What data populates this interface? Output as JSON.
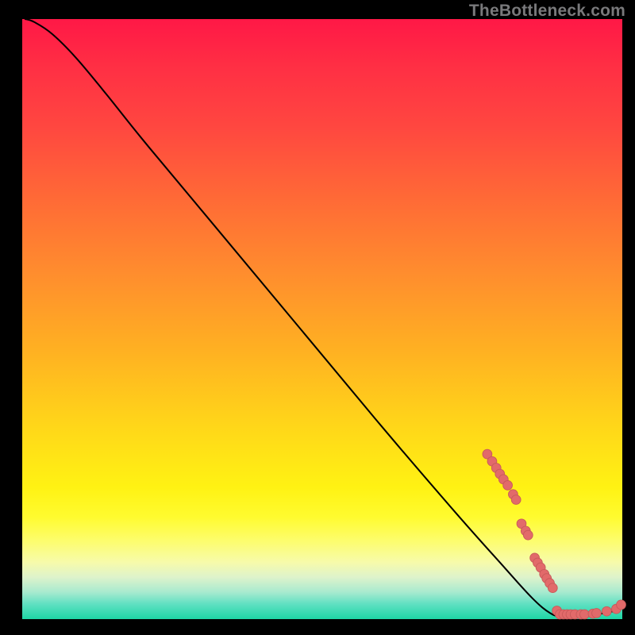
{
  "watermark": "TheBottleneck.com",
  "colors": {
    "curve": "#000000",
    "dot_fill": "#e26a6a",
    "dot_stroke": "#c85a5a"
  },
  "chart_data": {
    "type": "line",
    "title": "",
    "xlabel": "",
    "ylabel": "",
    "xlim": [
      0,
      100
    ],
    "ylim": [
      0,
      100
    ],
    "curve": [
      {
        "x": 0.5,
        "y": 100
      },
      {
        "x": 2,
        "y": 99.5
      },
      {
        "x": 5,
        "y": 97.5
      },
      {
        "x": 9,
        "y": 93.5
      },
      {
        "x": 14,
        "y": 87.5
      },
      {
        "x": 20,
        "y": 80
      },
      {
        "x": 30,
        "y": 68
      },
      {
        "x": 45,
        "y": 50
      },
      {
        "x": 60,
        "y": 32
      },
      {
        "x": 72,
        "y": 18
      },
      {
        "x": 80,
        "y": 9
      },
      {
        "x": 85,
        "y": 3.5
      },
      {
        "x": 88,
        "y": 1.0
      },
      {
        "x": 90,
        "y": 0.5
      },
      {
        "x": 94,
        "y": 0.7
      },
      {
        "x": 97,
        "y": 1.0
      },
      {
        "x": 99,
        "y": 1.5
      },
      {
        "x": 100,
        "y": 2.2
      }
    ],
    "points": [
      {
        "x": 77.5,
        "y": 27.5
      },
      {
        "x": 78.3,
        "y": 26.3
      },
      {
        "x": 79.0,
        "y": 25.2
      },
      {
        "x": 79.6,
        "y": 24.2
      },
      {
        "x": 80.2,
        "y": 23.3
      },
      {
        "x": 80.9,
        "y": 22.3
      },
      {
        "x": 81.8,
        "y": 20.8
      },
      {
        "x": 82.3,
        "y": 19.9
      },
      {
        "x": 83.2,
        "y": 15.9
      },
      {
        "x": 83.9,
        "y": 14.7
      },
      {
        "x": 84.3,
        "y": 14.0
      },
      {
        "x": 85.4,
        "y": 10.2
      },
      {
        "x": 85.9,
        "y": 9.4
      },
      {
        "x": 86.4,
        "y": 8.6
      },
      {
        "x": 87.0,
        "y": 7.5
      },
      {
        "x": 87.4,
        "y": 6.8
      },
      {
        "x": 87.9,
        "y": 6.0
      },
      {
        "x": 88.4,
        "y": 5.2
      },
      {
        "x": 89.1,
        "y": 1.4
      },
      {
        "x": 89.6,
        "y": 0.8
      },
      {
        "x": 90.2,
        "y": 0.8
      },
      {
        "x": 90.8,
        "y": 0.8
      },
      {
        "x": 91.4,
        "y": 0.8
      },
      {
        "x": 92.1,
        "y": 0.8
      },
      {
        "x": 93.1,
        "y": 0.8
      },
      {
        "x": 93.7,
        "y": 0.8
      },
      {
        "x": 95.1,
        "y": 0.9
      },
      {
        "x": 95.7,
        "y": 1.0
      },
      {
        "x": 97.4,
        "y": 1.3
      },
      {
        "x": 99.0,
        "y": 1.7
      },
      {
        "x": 99.8,
        "y": 2.4
      }
    ],
    "dot_radius": 0.78
  }
}
